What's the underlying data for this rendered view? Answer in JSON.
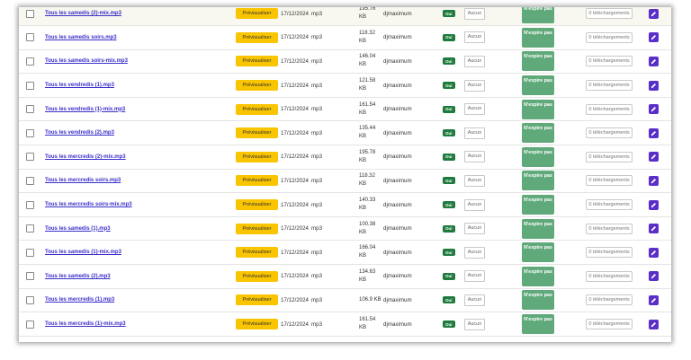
{
  "table": {
    "preview_label": "Prévisualiser",
    "format": "mp3",
    "date": "17/12/2024",
    "user": "djmaximum",
    "active_label": "Oui",
    "password_label": "Aucun",
    "expire_label": "N'expire pas",
    "downloads_label": "0 téléchargements",
    "edit_icon": "pencil-icon",
    "rows": [
      {
        "name": "Tous les samedis (2)-mix.mp3",
        "size": "195.76 KB"
      },
      {
        "name": "Tous les samedis soirs.mp3",
        "size": "118.32 KB"
      },
      {
        "name": "Tous les samedis soirs-mix.mp3",
        "size": "146.04 KB"
      },
      {
        "name": "Tous les vendredis (1).mp3",
        "size": "121.58 KB"
      },
      {
        "name": "Tous les vendredis (1)-mix.mp3",
        "size": "161.54 KB"
      },
      {
        "name": "Tous les vendredis (2).mp3",
        "size": "135.44 KB"
      },
      {
        "name": "Tous les mercredis (2)-mix.mp3",
        "size": "195.78 KB"
      },
      {
        "name": "Tous les mercredis soirs.mp3",
        "size": "118.32 KB"
      },
      {
        "name": "Tous les mercredis soirs-mix.mp3",
        "size": "140.33 KB"
      },
      {
        "name": "Tous les samedis (1).mp3",
        "size": "100.38 KB"
      },
      {
        "name": "Tous les samedis (1)-mix.mp3",
        "size": "166.04 KB"
      },
      {
        "name": "Tous les samedis (2).mp3",
        "size": "134.63 KB"
      },
      {
        "name": "Tous les mercredis (1).mp3",
        "size": "106.9 KB"
      },
      {
        "name": "Tous les mercredis (1)-mix.mp3",
        "size": "161.54 KB"
      }
    ]
  }
}
